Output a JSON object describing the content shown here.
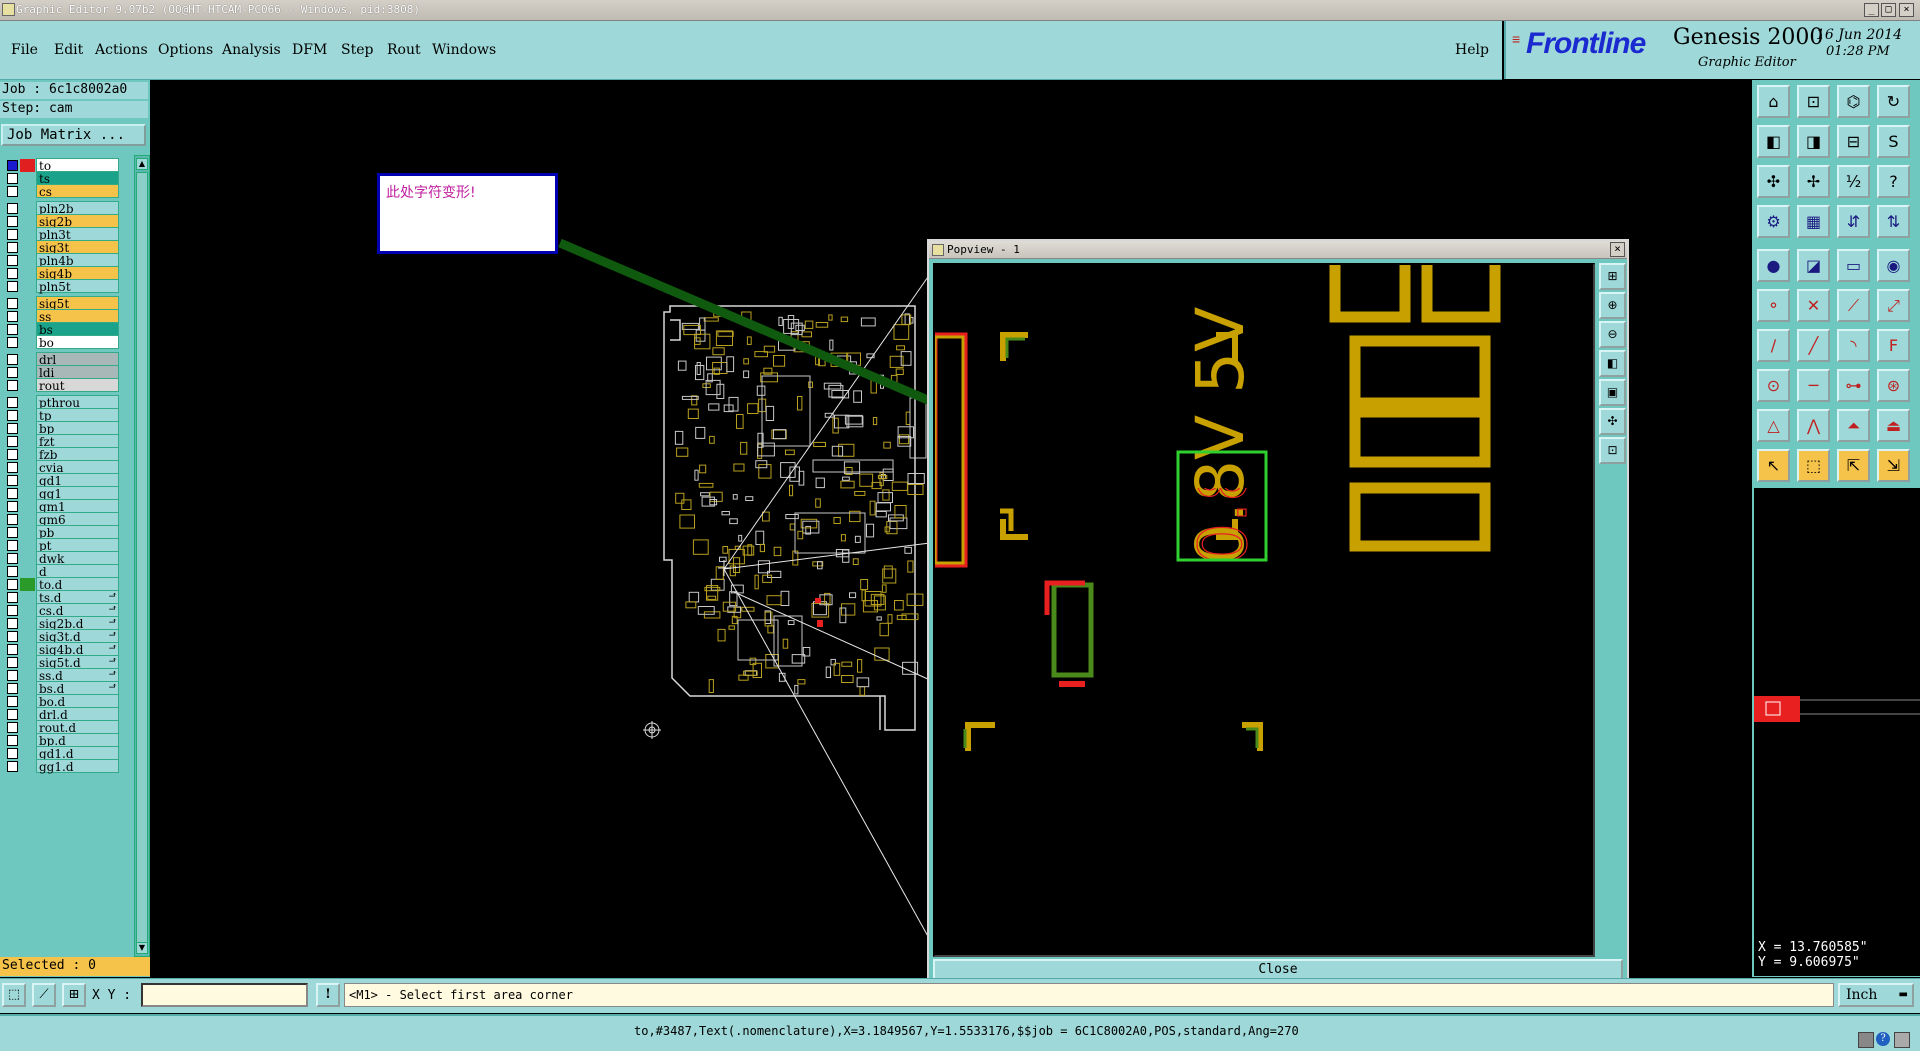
{
  "window": {
    "title": "Graphic Editor 9.07b2 (OO@HT-HTCAM-PC066 - Windows, pid:3808)"
  },
  "menu": {
    "items": [
      "File",
      "Edit",
      "Actions",
      "Options",
      "Analysis",
      "DFM",
      "Step",
      "Rout",
      "Windows"
    ],
    "help": "Help"
  },
  "brand": {
    "logo": "Frontline",
    "product": "Genesis 2000",
    "subtitle": "Graphic Editor",
    "date": "16 Jun 2014",
    "time": "01:28 PM"
  },
  "job": {
    "job_label": "Job : 6c1c8002a0",
    "step_label": "Step: cam",
    "matrix_button": "Job Matrix ..."
  },
  "layers": [
    {
      "name": "to",
      "color": "#ffffff",
      "swatch": "#e02020",
      "first": true
    },
    {
      "name": "ts",
      "color": "#1aa38a"
    },
    {
      "name": "cs",
      "color": "#f5c24a"
    },
    {
      "name": "pln2b",
      "color": "#9ed8d8"
    },
    {
      "name": "sig2b",
      "color": "#f5c24a"
    },
    {
      "name": "pln3t",
      "color": "#9ed8d8"
    },
    {
      "name": "sig3t",
      "color": "#f5c24a"
    },
    {
      "name": "pln4b",
      "color": "#9ed8d8"
    },
    {
      "name": "sig4b",
      "color": "#f5c24a"
    },
    {
      "name": "pln5t",
      "color": "#9ed8d8"
    },
    {
      "name": "sig5t",
      "color": "#f5c24a"
    },
    {
      "name": "ss",
      "color": "#f5c24a"
    },
    {
      "name": "bs",
      "color": "#1aa38a"
    },
    {
      "name": "bo",
      "color": "#ffffff"
    },
    {
      "name": "drl",
      "color": "#a8b8b8"
    },
    {
      "name": "ldi",
      "color": "#a8b8b8"
    },
    {
      "name": "rout",
      "color": "#d8d8d8"
    },
    {
      "name": "pthrou",
      "color": "#9ed8d8"
    },
    {
      "name": "tp",
      "color": "#9ed8d8"
    },
    {
      "name": "bp",
      "color": "#9ed8d8"
    },
    {
      "name": "fzt",
      "color": "#9ed8d8"
    },
    {
      "name": "fzb",
      "color": "#9ed8d8"
    },
    {
      "name": "cvia",
      "color": "#9ed8d8"
    },
    {
      "name": "gd1",
      "color": "#9ed8d8"
    },
    {
      "name": "gg1",
      "color": "#9ed8d8"
    },
    {
      "name": "gm1",
      "color": "#9ed8d8"
    },
    {
      "name": "gm6",
      "color": "#9ed8d8"
    },
    {
      "name": "pb",
      "color": "#9ed8d8"
    },
    {
      "name": "pt",
      "color": "#9ed8d8"
    },
    {
      "name": "dwk",
      "color": "#9ed8d8"
    },
    {
      "name": "d",
      "color": "#9ed8d8"
    },
    {
      "name": "to.d",
      "color": "#9ed8d8",
      "swatch": "#2a9a2a"
    },
    {
      "name": "ts.d",
      "color": "#9ed8d8",
      "mark": true
    },
    {
      "name": "cs.d",
      "color": "#9ed8d8",
      "mark": true
    },
    {
      "name": "sig2b.d",
      "color": "#9ed8d8",
      "mark": true
    },
    {
      "name": "sig3t.d",
      "color": "#9ed8d8",
      "mark": true
    },
    {
      "name": "sig4b.d",
      "color": "#9ed8d8",
      "mark": true
    },
    {
      "name": "sig5t.d",
      "color": "#9ed8d8",
      "mark": true
    },
    {
      "name": "ss.d",
      "color": "#9ed8d8",
      "mark": true
    },
    {
      "name": "bs.d",
      "color": "#9ed8d8",
      "mark": true
    },
    {
      "name": "bo.d",
      "color": "#9ed8d8"
    },
    {
      "name": "drl.d",
      "color": "#9ed8d8"
    },
    {
      "name": "rout.d",
      "color": "#9ed8d8"
    },
    {
      "name": "bp.d",
      "color": "#9ed8d8"
    },
    {
      "name": "gd1.d",
      "color": "#9ed8d8"
    },
    {
      "name": "gg1.d",
      "color": "#9ed8d8"
    }
  ],
  "selected": "Selected : 0",
  "annotation": {
    "text": "此处字符变形!"
  },
  "popview": {
    "title": "Popview - 1",
    "close": "Close",
    "text_value": "0.8V 5V"
  },
  "coords": {
    "x": "X = 13.760585\"",
    "y": "Y =  9.606975\""
  },
  "command": {
    "xy_label": "X Y :",
    "xy_value": "",
    "prompt": "<M1> - Select first area corner",
    "units": "Inch"
  },
  "status": {
    "text": "to,#3487,Text(.nomenclature),X=3.1849567,Y=1.5533176,$$job = 6C1C8002A0,POS,standard,Ang=270"
  },
  "toolbar_icons": [
    "zoom-home-icon",
    "zoom-in-icon",
    "zoom-out-icon",
    "redraw-icon",
    "pan-left-icon",
    "pan-right-icon",
    "zoom-window-icon",
    "snap-icon",
    "fit-icon",
    "center-icon",
    "scale-icon",
    "help-icon",
    "measure-icon",
    "grid-icon",
    "layer-up-icon",
    "layer-down-icon",
    "pad-icon",
    "surface-icon",
    "ruler-icon",
    "circle-icon",
    "net-icon",
    "cross-icon",
    "node-icon",
    "connect-icon",
    "line-icon",
    "diagonal-icon",
    "arc-icon",
    "text-icon",
    "pad-edit-icon",
    "trace-icon",
    "spacing-icon",
    "cluster-icon",
    "polygon-icon",
    "arc-draw-icon",
    "outline-icon",
    "shape-icon",
    "select-icon",
    "select-box-icon",
    "select-touch-icon",
    "select-net-icon"
  ],
  "colors": {
    "panel": "#9ed8d8",
    "accent": "#f5c24a",
    "board_outline": "#d8d8d8",
    "copper": "#c8a000",
    "highlight_green": "#30d030",
    "red": "#e82020"
  }
}
